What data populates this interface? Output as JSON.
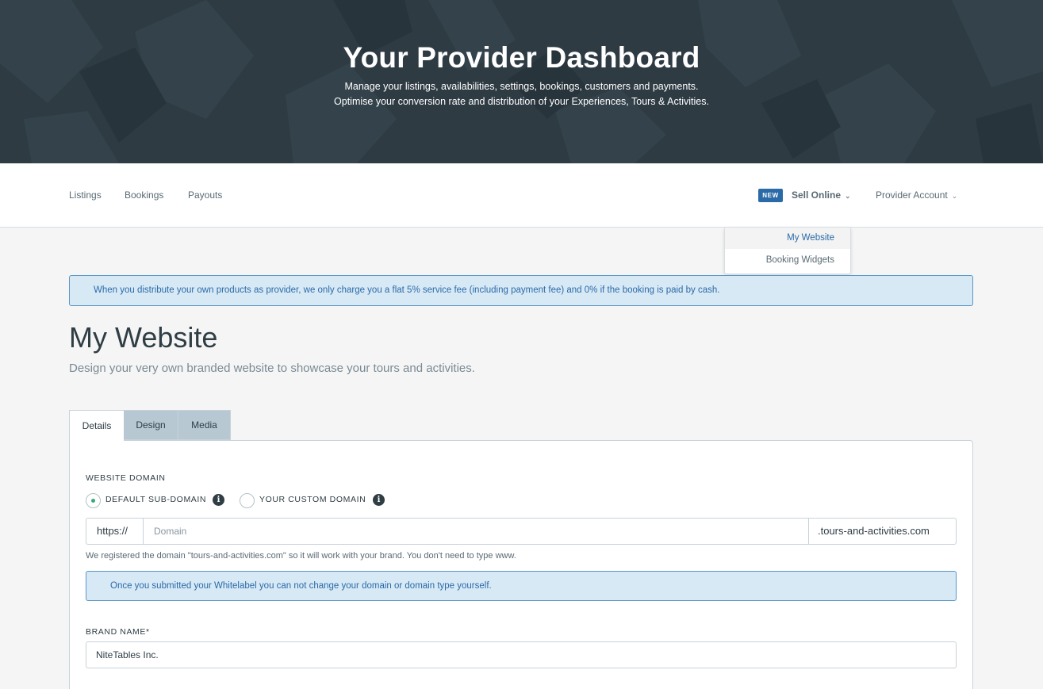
{
  "hero": {
    "title": "Your Provider Dashboard",
    "subtitle_line1": "Manage your listings, availabilities, settings, bookings, customers and payments.",
    "subtitle_line2": "Optimise your conversion rate and distribution of your Experiences, Tours & Activities.",
    "bg_color": "#2e3b43"
  },
  "nav": {
    "links": [
      {
        "label": "Listings"
      },
      {
        "label": "Bookings"
      },
      {
        "label": "Payouts"
      }
    ],
    "badge": "NEW",
    "sell_online": "Sell Online",
    "provider_account": "Provider Account",
    "chevron": "⌄"
  },
  "dropdown": {
    "items": [
      {
        "label": "My Website",
        "active": true
      },
      {
        "label": "Booking Widgets",
        "active": false
      }
    ]
  },
  "notice": "When you distribute your own products as provider, we only charge you a flat 5% service fee (including payment fee) and 0% if the booking is paid by cash.",
  "page": {
    "title": "My Website",
    "subtitle": "Design your very own branded website to showcase your tours and activities."
  },
  "tabs": [
    {
      "label": "Details",
      "active": true
    },
    {
      "label": "Design",
      "active": false
    },
    {
      "label": "Media",
      "active": false
    }
  ],
  "form": {
    "domain_label": "WEBSITE DOMAIN",
    "radio_default": "DEFAULT SUB-DOMAIN",
    "radio_custom": "YOUR CUSTOM DOMAIN",
    "selected_radio": "DEFAULT SUB-DOMAIN",
    "info_glyph": "i",
    "prefix": "https://",
    "domain_placeholder": "Domain",
    "domain_value": "",
    "suffix": ".tours-and-activities.com",
    "help_text": "We registered the domain \"tours-and-activities.com\" so it will work with your brand. You don't need to type www.",
    "domain_notice": "Once you submitted your Whitelabel you can not change your domain or domain type yourself.",
    "brand_label": "BRAND NAME*",
    "brand_value": "NiteTables Inc."
  },
  "colors": {
    "accent": "#2a6aa7",
    "radio_selected": "#3aa87a",
    "notice_bg": "#d8e9f6"
  }
}
